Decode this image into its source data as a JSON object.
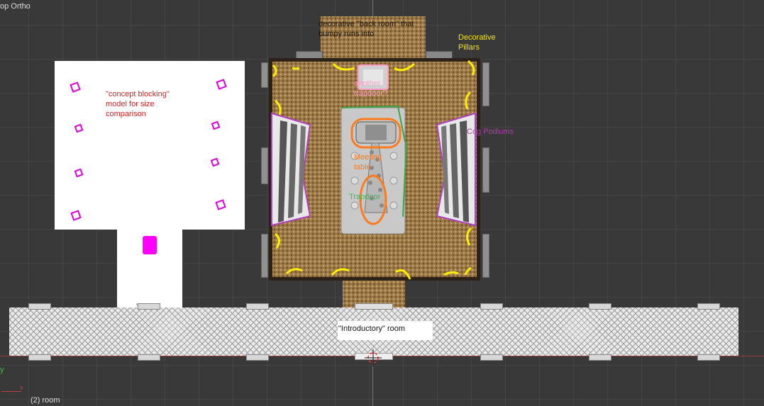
{
  "viewport": {
    "view_label": "op Ortho",
    "axis_y_label": "y",
    "axis_x_label": "x",
    "object_label": "(2) room"
  },
  "annotations": {
    "back_room": "decorative \"back room\" that\nbumpy runs into",
    "pillars": "Decorative\nPillars",
    "concept": "\"concept blocking\"\nmodel for size\ncomparison",
    "another_trapdoor": "another\ntrapdoor?",
    "cog_podiums": "Cog Podiums",
    "meeting_table": "Meeting\ntable",
    "trapdoor": "Trapdoor",
    "intro_room": "\"Introductory\" room"
  },
  "colors": {
    "background": "#393939",
    "back_room_note": "#111111",
    "pillars_note": "#f5e600",
    "concept_note": "#e01818",
    "another_trapdoor_note": "#ff9dc4",
    "cog_podiums_note": "#b03cb0",
    "meeting_table_note": "#ff7a1c",
    "trapdoor_note": "#2ec04a",
    "intro_note": "#111111",
    "pillar_marks": "#ffee00"
  }
}
